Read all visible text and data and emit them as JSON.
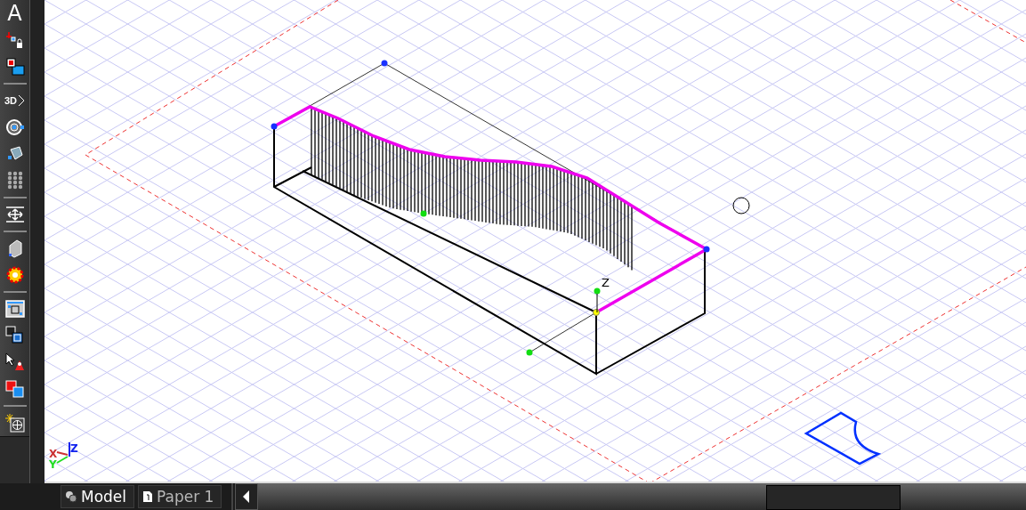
{
  "toolbar": {
    "text_glyph": "A",
    "three_d_glyph": "3D"
  },
  "viewport": {
    "point_axis_label": "Z",
    "axis_labels": {
      "x": "X",
      "y": "Y",
      "z": "Z"
    }
  },
  "tabs": [
    {
      "label": "Model",
      "selected": true,
      "kind": "model"
    },
    {
      "label": "Paper 1",
      "selected": false,
      "kind": "paper"
    }
  ]
}
